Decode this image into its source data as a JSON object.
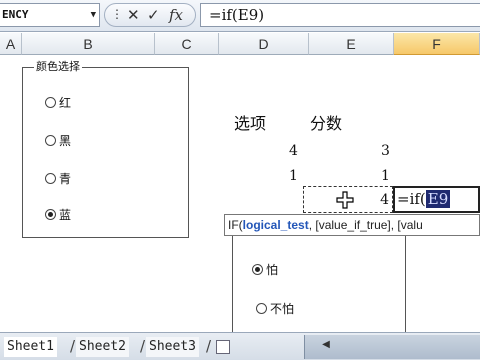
{
  "formula_bar": {
    "name_box": "ENCY",
    "cancel_symbol": "✕",
    "enter_symbol": "✓",
    "fx_symbol": "fx",
    "formula": "=if(E9)"
  },
  "columns": [
    "A",
    "B",
    "C",
    "D",
    "E",
    "F"
  ],
  "group_box_1": {
    "title": "颜色选择",
    "options": [
      {
        "label": "红",
        "checked": false
      },
      {
        "label": "黑",
        "checked": false
      },
      {
        "label": "青",
        "checked": false
      },
      {
        "label": "蓝",
        "checked": true
      }
    ]
  },
  "cells": {
    "header_option": "选项",
    "header_score": "分数",
    "d_row1": "4",
    "e_row1": "3",
    "d_row2": "1",
    "e_row2": "1",
    "e_row3": "4",
    "editing_prefix": "=if(",
    "editing_ref": "E9"
  },
  "tooltip": {
    "prefix": "IF(",
    "bold_param": "logical_test",
    "rest": ", [value_if_true], [valu"
  },
  "group_box_2": {
    "options": [
      {
        "label": "怕",
        "checked": true
      },
      {
        "label": "不怕",
        "checked": false
      }
    ]
  },
  "sheet_tabs": [
    "Sheet1",
    "Sheet2",
    "Sheet3"
  ],
  "colors": {
    "active_column": "#f6c86a",
    "ref_highlight": "#1f2a70"
  }
}
